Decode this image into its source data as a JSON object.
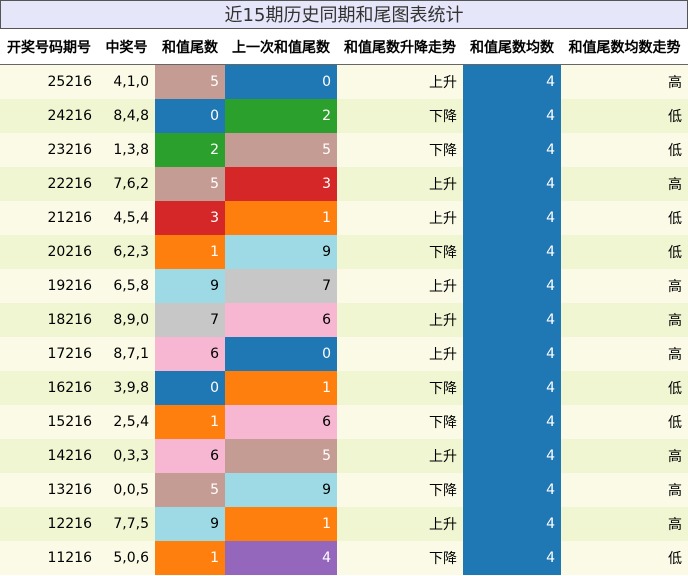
{
  "title": "近15期历史同期和尾图表统计",
  "headers": [
    "开奖号码期号",
    "中奖号",
    "和值尾数",
    "上一次和值尾数",
    "和值尾数升降走势",
    "和值尾数均数",
    "和值尾数均数走势"
  ],
  "colors": {
    "0": "#1f77b4",
    "1": "#ff7f0e",
    "2": "#2ca02c",
    "3": "#d62728",
    "4": "#9467bd",
    "5": "#c49c94",
    "6": "#f7b6d2",
    "7": "#c7c7c7",
    "9": "#9edae5",
    "avg": "#1f77b4",
    "row_odd": "#fafae6",
    "row_even": "#f0f5d2"
  },
  "rows": [
    {
      "period": "25216",
      "numbers": "4,1,0",
      "tail": "5",
      "prev_tail": "0",
      "trend": "上升",
      "avg": "4",
      "avg_trend": "高"
    },
    {
      "period": "24216",
      "numbers": "8,4,8",
      "tail": "0",
      "prev_tail": "2",
      "trend": "下降",
      "avg": "4",
      "avg_trend": "低"
    },
    {
      "period": "23216",
      "numbers": "1,3,8",
      "tail": "2",
      "prev_tail": "5",
      "trend": "下降",
      "avg": "4",
      "avg_trend": "低"
    },
    {
      "period": "22216",
      "numbers": "7,6,2",
      "tail": "5",
      "prev_tail": "3",
      "trend": "上升",
      "avg": "4",
      "avg_trend": "高"
    },
    {
      "period": "21216",
      "numbers": "4,5,4",
      "tail": "3",
      "prev_tail": "1",
      "trend": "上升",
      "avg": "4",
      "avg_trend": "低"
    },
    {
      "period": "20216",
      "numbers": "6,2,3",
      "tail": "1",
      "prev_tail": "9",
      "trend": "下降",
      "avg": "4",
      "avg_trend": "低"
    },
    {
      "period": "19216",
      "numbers": "6,5,8",
      "tail": "9",
      "prev_tail": "7",
      "trend": "上升",
      "avg": "4",
      "avg_trend": "高"
    },
    {
      "period": "18216",
      "numbers": "8,9,0",
      "tail": "7",
      "prev_tail": "6",
      "trend": "上升",
      "avg": "4",
      "avg_trend": "高"
    },
    {
      "period": "17216",
      "numbers": "8,7,1",
      "tail": "6",
      "prev_tail": "0",
      "trend": "上升",
      "avg": "4",
      "avg_trend": "高"
    },
    {
      "period": "16216",
      "numbers": "3,9,8",
      "tail": "0",
      "prev_tail": "1",
      "trend": "下降",
      "avg": "4",
      "avg_trend": "低"
    },
    {
      "period": "15216",
      "numbers": "2,5,4",
      "tail": "1",
      "prev_tail": "6",
      "trend": "下降",
      "avg": "4",
      "avg_trend": "低"
    },
    {
      "period": "14216",
      "numbers": "0,3,3",
      "tail": "6",
      "prev_tail": "5",
      "trend": "上升",
      "avg": "4",
      "avg_trend": "高"
    },
    {
      "period": "13216",
      "numbers": "0,0,5",
      "tail": "5",
      "prev_tail": "9",
      "trend": "下降",
      "avg": "4",
      "avg_trend": "高"
    },
    {
      "period": "12216",
      "numbers": "7,7,5",
      "tail": "9",
      "prev_tail": "1",
      "trend": "上升",
      "avg": "4",
      "avg_trend": "高"
    },
    {
      "period": "11216",
      "numbers": "5,0,6",
      "tail": "1",
      "prev_tail": "4",
      "trend": "下降",
      "avg": "4",
      "avg_trend": "低"
    }
  ]
}
